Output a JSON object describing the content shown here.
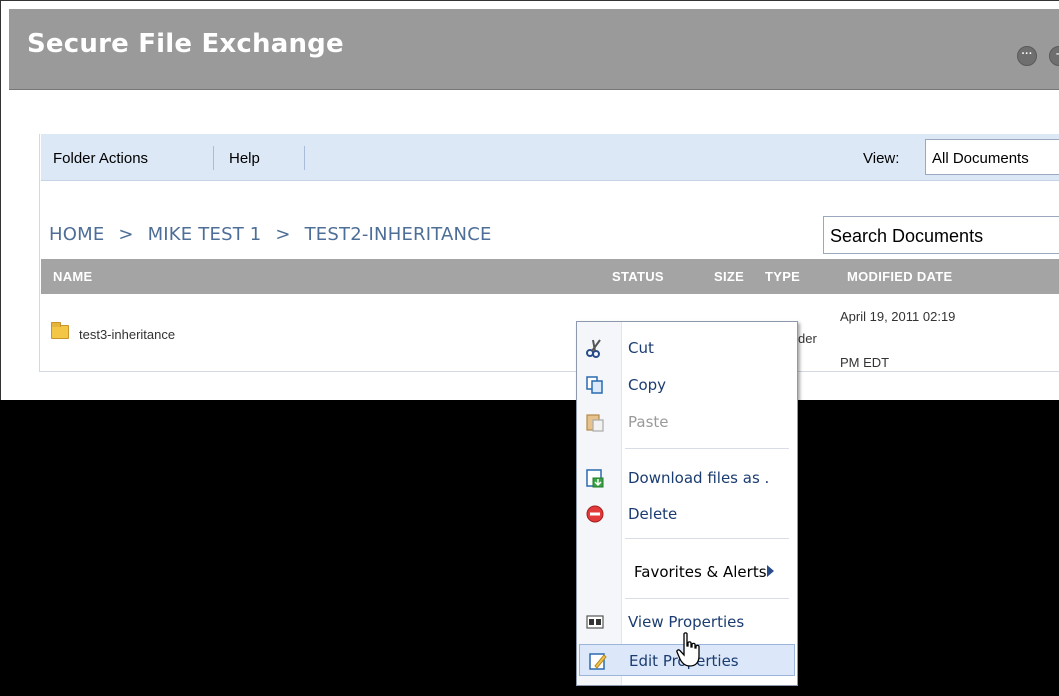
{
  "window": {
    "title": "Secure File Exchange"
  },
  "toolbar": {
    "folder_actions": "Folder Actions",
    "help": "Help",
    "view_label": "View:",
    "view_value": "All Documents"
  },
  "breadcrumb": [
    "HOME",
    ">",
    "MIKE TEST 1",
    ">",
    "TEST2-INHERITANCE"
  ],
  "search": {
    "placeholder": "Search Documents"
  },
  "columns": {
    "name": "NAME",
    "status": "STATUS",
    "size": "SIZE",
    "type": "TYPE",
    "modified": "MODIFIED DATE"
  },
  "rows": [
    {
      "name": "test3-inheritance",
      "type_partial": "der",
      "modified_line1": "April 19, 2011 02:19",
      "modified_line2": "PM EDT"
    }
  ],
  "context_menu": {
    "items": [
      {
        "label": "Cut",
        "icon": "scissors-icon",
        "enabled": true
      },
      {
        "label": "Copy",
        "icon": "copy-icon",
        "enabled": true
      },
      {
        "label": "Paste",
        "icon": "paste-icon",
        "enabled": false
      },
      {
        "label": "Download files as .",
        "icon": "download-icon",
        "enabled": true
      },
      {
        "label": "Delete",
        "icon": "delete-icon",
        "enabled": true
      },
      {
        "label": "Favorites & Alerts",
        "icon": "",
        "enabled": true,
        "submenu": true
      },
      {
        "label": "View Properties",
        "icon": "properties-icon",
        "enabled": true
      },
      {
        "label": "Edit Properties",
        "icon": "edit-icon",
        "enabled": true,
        "hover": true
      }
    ]
  },
  "colors": {
    "titlebar": "#9a9a9a",
    "toolbar": "#dde8f6",
    "breadcrumb": "#4d6e97",
    "grid_header": "#a4a4a4",
    "menu_text": "#1b3c70"
  }
}
